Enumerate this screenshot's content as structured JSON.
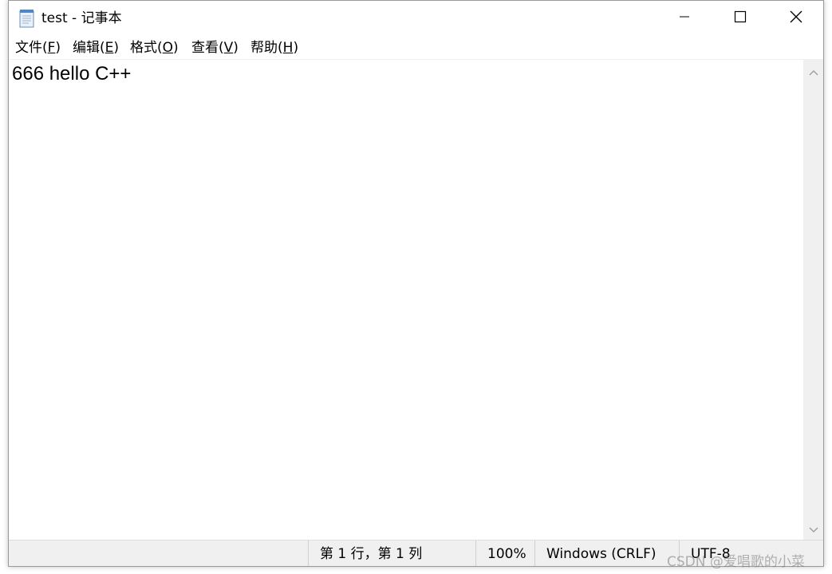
{
  "window": {
    "title": "test - 记事本",
    "controls": {
      "minimize": "minimize",
      "maximize": "maximize",
      "close": "close"
    }
  },
  "menu": {
    "items": [
      {
        "label": "文件(",
        "accel": "F",
        "suffix": ")"
      },
      {
        "label": "编辑(",
        "accel": "E",
        "suffix": ")"
      },
      {
        "label": "格式(",
        "accel": "O",
        "suffix": ")"
      },
      {
        "label": "查看(",
        "accel": "V",
        "suffix": ")"
      },
      {
        "label": "帮助(",
        "accel": "H",
        "suffix": ")"
      }
    ]
  },
  "editor": {
    "content": "666 hello C++"
  },
  "status": {
    "position": "第 1 行，第 1 列",
    "zoom": "100%",
    "line_ending": "Windows (CRLF)",
    "encoding": "UTF-8"
  },
  "watermark": "CSDN @爱唱歌的小菜",
  "icons": {
    "app": "notepad-icon",
    "minimize": "minimize-icon",
    "maximize": "maximize-icon",
    "close": "close-icon",
    "scroll_up": "chevron-up-icon",
    "scroll_down": "chevron-down-icon"
  }
}
